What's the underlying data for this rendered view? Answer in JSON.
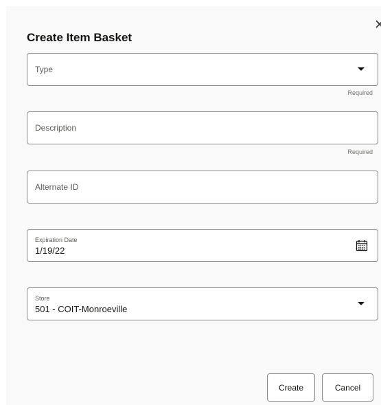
{
  "dialog": {
    "title": "Create Item Basket",
    "close_icon": "close-icon"
  },
  "fields": {
    "type": {
      "placeholder": "Type",
      "helper": "Required",
      "icon": "chevron-down-icon"
    },
    "description": {
      "placeholder": "Description",
      "helper": "Required"
    },
    "alternate_id": {
      "placeholder": "Alternate ID"
    },
    "expiration_date": {
      "label": "Expiration Date",
      "value": "1/19/22",
      "icon": "calendar-icon"
    },
    "store": {
      "label": "Store",
      "value": "501 - COIT-Monroeville",
      "icon": "chevron-down-icon"
    }
  },
  "buttons": {
    "create": "Create",
    "cancel": "Cancel"
  },
  "colors": {
    "dialog_bg": "#f9f9f9",
    "field_border": "#8a8986",
    "text": "#161513",
    "placeholder": "#5a5956"
  }
}
